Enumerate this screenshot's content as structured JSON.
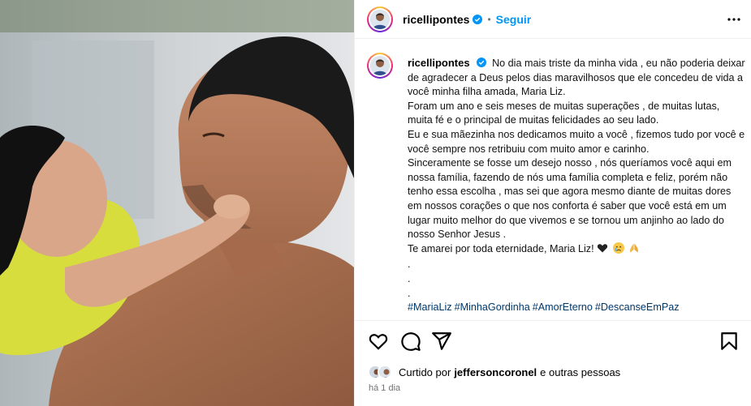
{
  "post": {
    "username": "ricellipontes",
    "follow_label": "Seguir",
    "separator": "•",
    "caption_lines": [
      "No dia mais triste da minha vida , eu não poderia deixar de agradecer a Deus pelos dias maravilhosos que ele concedeu de vida a você minha filha amada, Maria Liz.",
      "Foram um ano e seis meses de muitas superações , de muitas lutas, muita fé e o principal de muitas felicidades ao seu lado.",
      "Eu e sua mãezinha nos dedicamos muito a você , fizemos tudo por você e você sempre nos retribuiu com muito amor e carinho.",
      "Sinceramente se fosse um desejo nosso , nós queríamos você aqui em nossa família, fazendo de nós uma família completa e feliz, porém não tenho essa escolha , mas sei que agora mesmo diante de muitas dores em nossos corações o que nos conforta é saber que você está em um lugar muito melhor do que vivemos e se tornou um anjinho ao lado do nosso Senhor Jesus .",
      "Te amarei por toda eternidade, Maria Liz!"
    ],
    "dots": [
      ".",
      ".",
      "."
    ],
    "hashtags": [
      "#MariaLiz",
      "#MinhaGordinha",
      "#AmorEterno",
      "#DescanseEmPaz"
    ],
    "emojis": [
      "black-heart",
      "crying-face",
      "folded-hands"
    ],
    "likes": {
      "prefix": "Curtido por",
      "user": "jeffersoncoronel",
      "suffix": "e outras pessoas"
    },
    "time_ago": "há 1 dia"
  },
  "colors": {
    "link_blue": "#0095f6",
    "hashtag": "#00376b",
    "muted": "#737373"
  }
}
